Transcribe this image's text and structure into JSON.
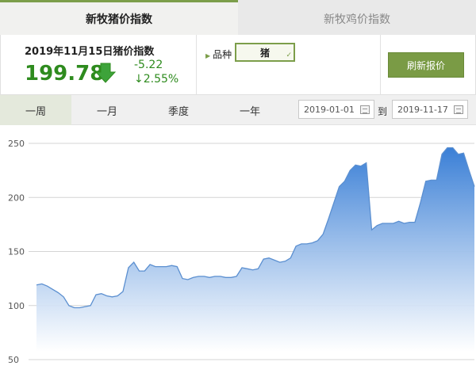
{
  "tabs": [
    {
      "label": "新牧猪价指数",
      "active": true
    },
    {
      "label": "新牧鸡价指数",
      "active": false
    }
  ],
  "index": {
    "title": "2019年11月15日猪价指数",
    "value": "199.78",
    "change": "-5.22",
    "change_pct": "↓2.55%",
    "trend_icon": "arrow-down-icon"
  },
  "variety": {
    "label": "品种",
    "selected": "猪"
  },
  "refresh_label": "刷新报价",
  "periods": [
    "一周",
    "一月",
    "季度",
    "一年"
  ],
  "date_range": {
    "start": "2019-01-01",
    "separator": "到",
    "end": "2019-11-17"
  },
  "colors": {
    "accent": "#7c9e4a",
    "value_green": "#2e8b1e",
    "line": "#5b8fd0"
  },
  "chart_data": {
    "type": "area",
    "yticks": [
      50,
      100,
      150,
      200,
      250
    ],
    "ylim": [
      50,
      250
    ],
    "grid": true,
    "series": [
      {
        "values": [
          119,
          120,
          118,
          115,
          112,
          108,
          100,
          98,
          98,
          99,
          100,
          110,
          111,
          109,
          108,
          109,
          113,
          135,
          140,
          132,
          132,
          138,
          136,
          136,
          136,
          137,
          136,
          125,
          124,
          126,
          127,
          127,
          126,
          127,
          127,
          126,
          126,
          127,
          135,
          134,
          133,
          134,
          143,
          144,
          142,
          140,
          141,
          144,
          155,
          157,
          157,
          158,
          160,
          166,
          180,
          195,
          210,
          215,
          225,
          230,
          229,
          232,
          170,
          174,
          176,
          176,
          176,
          178,
          176,
          177,
          177,
          195,
          215,
          216,
          216,
          240,
          246,
          246,
          240,
          241,
          225,
          210
        ]
      }
    ]
  }
}
